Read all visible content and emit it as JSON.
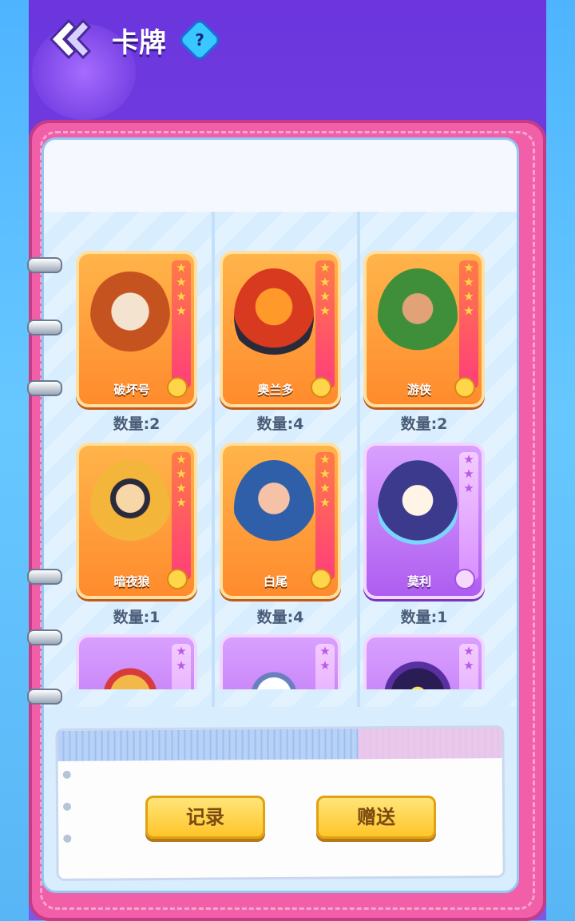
{
  "header": {
    "title": "卡牌",
    "help": "?"
  },
  "cards": [
    {
      "name": "破坏号",
      "quantity": "数量:2",
      "rarity": "orange",
      "stars": "★★★★"
    },
    {
      "name": "奥兰多",
      "quantity": "数量:4",
      "rarity": "orange",
      "stars": "★★★★"
    },
    {
      "name": "游侠",
      "quantity": "数量:2",
      "rarity": "orange",
      "stars": "★★★★"
    },
    {
      "name": "暗夜狼",
      "quantity": "数量:1",
      "rarity": "orange",
      "stars": "★★★★"
    },
    {
      "name": "白尾",
      "quantity": "数量:4",
      "rarity": "orange",
      "stars": "★★★★"
    },
    {
      "name": "莫利",
      "quantity": "数量:1",
      "rarity": "purple",
      "stars": "★★★"
    },
    {
      "name": "",
      "quantity": "",
      "rarity": "purple",
      "stars": "★★"
    },
    {
      "name": "",
      "quantity": "",
      "rarity": "purple",
      "stars": "★★"
    },
    {
      "name": "",
      "quantity": "",
      "rarity": "purple",
      "stars": "★★"
    }
  ],
  "buttons": {
    "record": "记录",
    "gift": "赠送"
  },
  "colors": {
    "orange_card": "#ff8b2d",
    "purple_card": "#ae5df0",
    "button": "#ffc52a"
  }
}
